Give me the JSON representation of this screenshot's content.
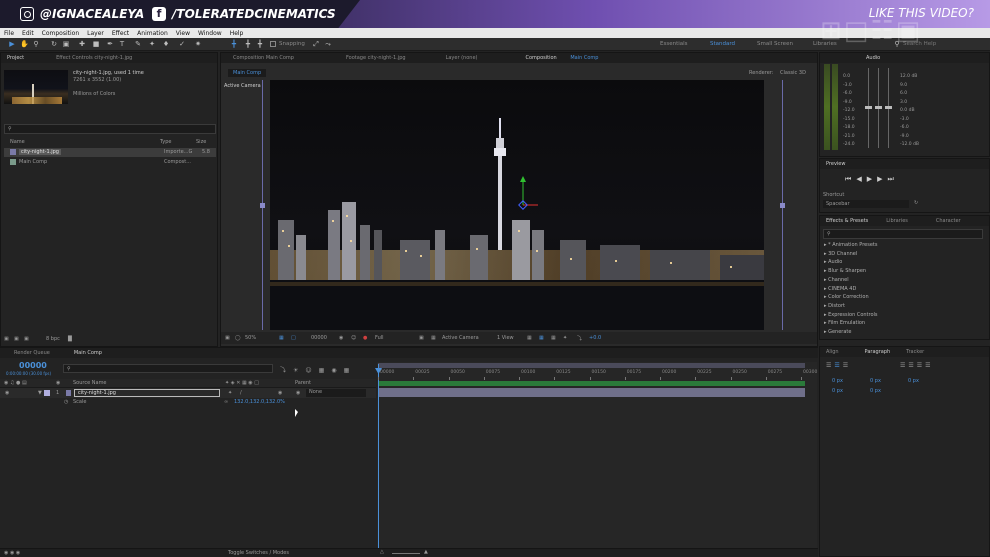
{
  "banner": {
    "instagram": "@IGNACEALEYA",
    "facebook": "/TOLERATEDCINEMATICS",
    "cta": "LIKE THIS VIDEO?"
  },
  "menu": [
    "File",
    "Edit",
    "Composition",
    "Layer",
    "Effect",
    "Animation",
    "View",
    "Window",
    "Help"
  ],
  "toolbar": {
    "snapping": "Snapping",
    "workspaces": [
      "Essentials",
      "Standard",
      "Small Screen",
      "Libraries"
    ],
    "active_workspace": "Standard",
    "search_placeholder": "Search Help"
  },
  "project_panel": {
    "tab_project": "Project",
    "tab_effect_controls": "Effect Controls city-night-1.jpg",
    "asset_name": "city-night-1.jpg",
    "asset_used": ", used 1 time",
    "asset_dims": "7261 x 3552 (1.00)",
    "asset_colors": "Millions of Colors",
    "col_name": "Name",
    "col_type": "Type",
    "col_size": "Size",
    "rows": [
      {
        "name": "city-night-1.jpg",
        "type": "Importe...G",
        "size": "5.8"
      },
      {
        "name": "Main Comp",
        "type": "Compost...",
        "size": ""
      }
    ],
    "bpc": "8 bpc"
  },
  "viewer_panel": {
    "tab_comp": "Composition Main Comp",
    "tab_footage": "Footage city-night-1.jpg",
    "tab_layer": "Layer (none)",
    "tab_comp_active_prefix": "Composition",
    "tab_comp_active_name": "Main Comp",
    "comp_button": "Main Comp",
    "renderer_label": "Renderer:",
    "renderer_value": "Classic 3D",
    "active_camera_label": "Active Camera",
    "zoom": "50%",
    "timecode": "00000",
    "resolution": "Full",
    "camera": "Active Camera",
    "view": "1 View",
    "exposure": "+0.0"
  },
  "audio_panel": {
    "tab": "Audio",
    "left_scale": [
      "0.0",
      "-3.0",
      "-6.0",
      "-9.0",
      "-12.0",
      "-15.0",
      "-18.0",
      "-21.0",
      "-24.0"
    ],
    "right_scale": [
      "12.0 dB",
      "9.0",
      "6.0",
      "3.0",
      "0.0 dB",
      "-3.0",
      "-6.0",
      "-9.0",
      "-12.0 dB"
    ]
  },
  "preview_panel": {
    "tab": "Preview",
    "shortcut_label": "Shortcut",
    "shortcut_value": "Spacebar"
  },
  "effects_panel": {
    "tab_effects": "Effects & Presets",
    "tab_libraries": "Libraries",
    "tab_character": "Character",
    "items": [
      "* Animation Presets",
      "3D Channel",
      "Audio",
      "Blur & Sharpen",
      "Channel",
      "CINEMA 4D",
      "Color Correction",
      "Distort",
      "Expression Controls",
      "Film Emulation",
      "Generate"
    ]
  },
  "paragraph_panel": {
    "tab_align": "Align",
    "tab_paragraph": "Paragraph",
    "tab_tracker": "Tracker",
    "values": [
      "0 px",
      "0 px",
      "0 px",
      "0 px",
      "0 px"
    ]
  },
  "timeline": {
    "tab_render_queue": "Render Queue",
    "tab_main_comp": "Main Comp",
    "timecode": "00000",
    "timecode_sub": "0:00:00:00 (30.00 fps)",
    "col_source_name": "Source Name",
    "col_parent": "Parent",
    "layer_number": "1",
    "layer_name": "city-night-1.jpg",
    "layer_parent": "None",
    "property_name": "Scale",
    "property_value": "132.0,132.0,132.0%",
    "ruler": [
      "00000",
      "00025",
      "00050",
      "00075",
      "00100",
      "00125",
      "00150",
      "00175",
      "00200",
      "00225",
      "00250",
      "00275",
      "00300"
    ],
    "toggle_label": "Toggle Switches / Modes"
  },
  "colors": {
    "accent_blue": "#4a90d9",
    "banner_purple": "#6f4fb0",
    "layer_bar": "#6f6f8a",
    "label_lavender": "#b0aede"
  }
}
